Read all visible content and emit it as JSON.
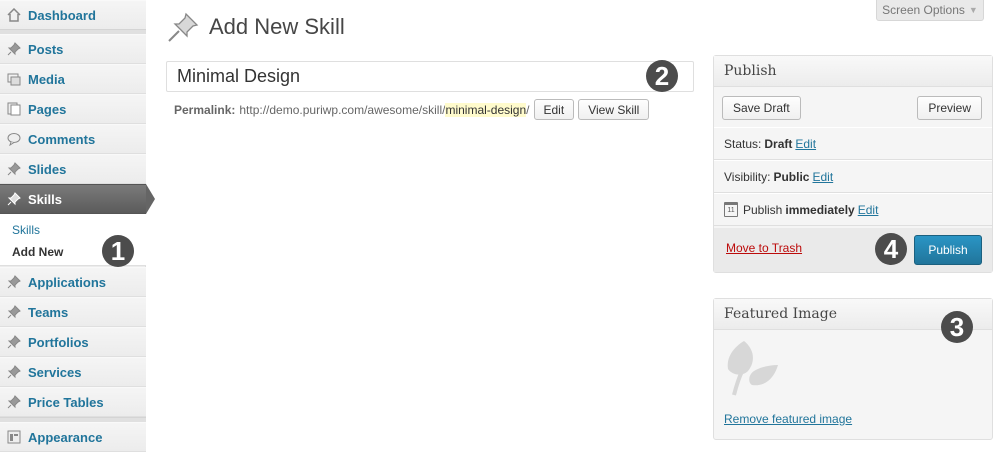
{
  "sidebar": {
    "items": [
      {
        "label": "Dashboard",
        "icon": "dashboard-icon"
      },
      {
        "label": "Posts",
        "icon": "pushpin-icon"
      },
      {
        "label": "Media",
        "icon": "media-icon"
      },
      {
        "label": "Pages",
        "icon": "pages-icon"
      },
      {
        "label": "Comments",
        "icon": "comments-icon"
      },
      {
        "label": "Slides",
        "icon": "pushpin-icon"
      },
      {
        "label": "Skills",
        "icon": "pushpin-icon"
      },
      {
        "label": "Applications",
        "icon": "pushpin-icon"
      },
      {
        "label": "Teams",
        "icon": "pushpin-icon"
      },
      {
        "label": "Portfolios",
        "icon": "pushpin-icon"
      },
      {
        "label": "Services",
        "icon": "pushpin-icon"
      },
      {
        "label": "Price Tables",
        "icon": "pushpin-icon"
      },
      {
        "label": "Appearance",
        "icon": "appearance-icon"
      }
    ],
    "current": "Skills",
    "submenu": [
      "Skills",
      "Add New"
    ],
    "submenu_current": "Add New"
  },
  "badges": [
    "1",
    "2",
    "3",
    "4"
  ],
  "header": {
    "screen_options": "Screen Options",
    "page_title": "Add New Skill"
  },
  "editor": {
    "title_value": "Minimal Design",
    "permalink_label": "Permalink:",
    "permalink_base": "http://demo.puriwp.com/awesome/skill/",
    "permalink_slug": "minimal-design",
    "permalink_trailing": "/",
    "edit_button": "Edit",
    "view_button": "View Skill"
  },
  "publish": {
    "title": "Publish",
    "save_draft": "Save Draft",
    "preview": "Preview",
    "status_label": "Status:",
    "status_value": "Draft",
    "visibility_label": "Visibility:",
    "visibility_value": "Public",
    "publish_label": "Publish",
    "publish_value": "immediately",
    "edit_link": "Edit",
    "move_to_trash": "Move to Trash",
    "publish_button": "Publish"
  },
  "featured": {
    "title": "Featured Image",
    "remove_link": "Remove featured image"
  },
  "colors": {
    "accent": "#21759b",
    "current_menu": "#656565",
    "trash": "#bc0b0b",
    "badge": "#4c4c4c"
  }
}
